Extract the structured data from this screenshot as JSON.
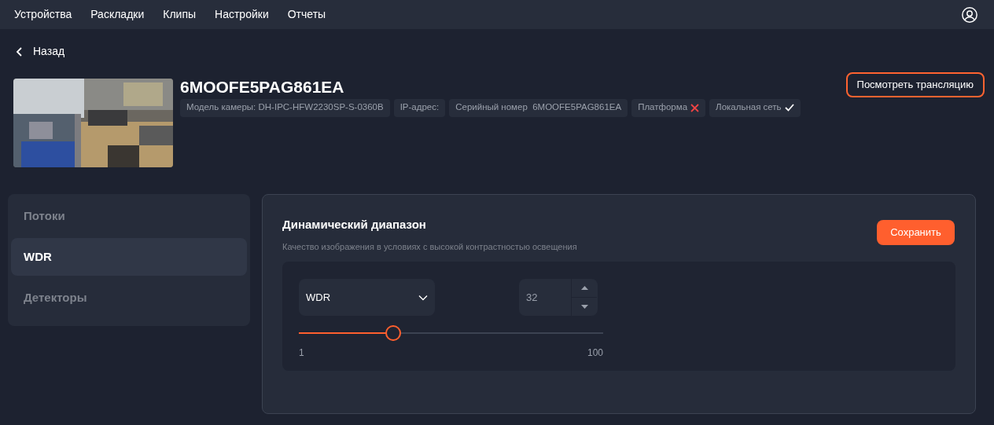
{
  "nav": {
    "items": [
      "Устройства",
      "Раскладки",
      "Клипы",
      "Настройки",
      "Отчеты"
    ]
  },
  "back": "Назад",
  "camera": {
    "title": "6MOOFE5PAG861EA",
    "tags": [
      {
        "kind": "text",
        "label": "Модель камеры: DH-IPC-HFW2230SP-S-0360B"
      },
      {
        "kind": "text",
        "label": "IP-адрес:"
      },
      {
        "kind": "text",
        "label": "Серийный номер  6MOOFE5PAG861EA"
      },
      {
        "kind": "status",
        "label": "Платформа",
        "ok": false
      },
      {
        "kind": "status",
        "label": "Локальная сеть",
        "ok": true
      }
    ],
    "watch_button": "Посмотреть трансляцию"
  },
  "sidebar": {
    "items": [
      {
        "label": "Потоки",
        "selected": false
      },
      {
        "label": "WDR",
        "selected": true
      },
      {
        "label": "Детекторы",
        "selected": false
      }
    ]
  },
  "panel": {
    "title": "Динамический диапазон",
    "subtitle": "Качество изображения в условиях с высокой контрастностью освещения",
    "save_button": "Сохранить",
    "mode_select": {
      "value": "WDR"
    },
    "value_field": {
      "value": "32"
    },
    "slider": {
      "level": 0.31,
      "min": "1",
      "max": "100"
    }
  }
}
